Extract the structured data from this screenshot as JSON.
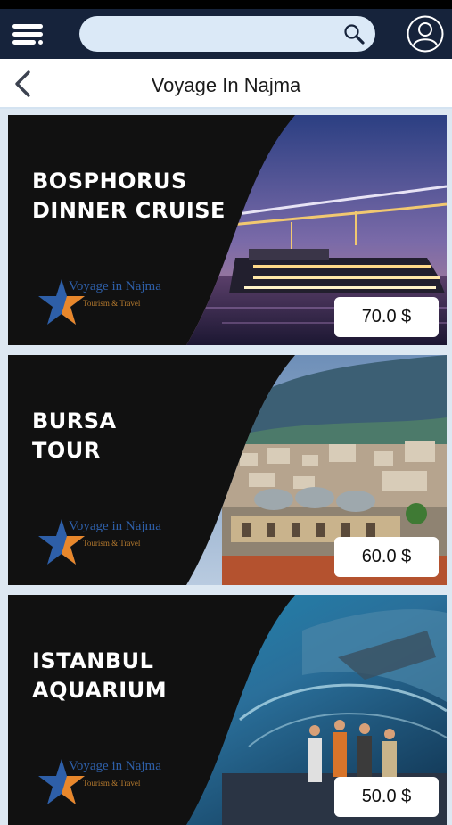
{
  "header": {
    "search": {
      "value": "",
      "placeholder": ""
    },
    "icons": [
      "menu-icon",
      "search-icon",
      "user-profile-icon"
    ]
  },
  "page": {
    "title": "Voyage In Najma",
    "back_icon": "chevron-left-icon"
  },
  "brand": {
    "logo_text": "Voyage in Najma",
    "logo_subtext": "Tourism & Travel"
  },
  "tours": [
    {
      "name_line1": "BOSPHORUS",
      "name_line2": "DINNER CRUISE",
      "price": "70.0 $"
    },
    {
      "name_line1": "BURSA",
      "name_line2": "TOUR",
      "price": "60.0 $"
    },
    {
      "name_line1": "ISTANBUL",
      "name_line2": "AQUARIUM",
      "price": "50.0 $"
    }
  ],
  "colors": {
    "appbar": "#16233b",
    "search_bg": "#dbe9f7",
    "page_bg": "#dde8f2",
    "card_bg": "#111111",
    "logo_blue": "#2e5fa8",
    "logo_orange": "#e8872b"
  }
}
